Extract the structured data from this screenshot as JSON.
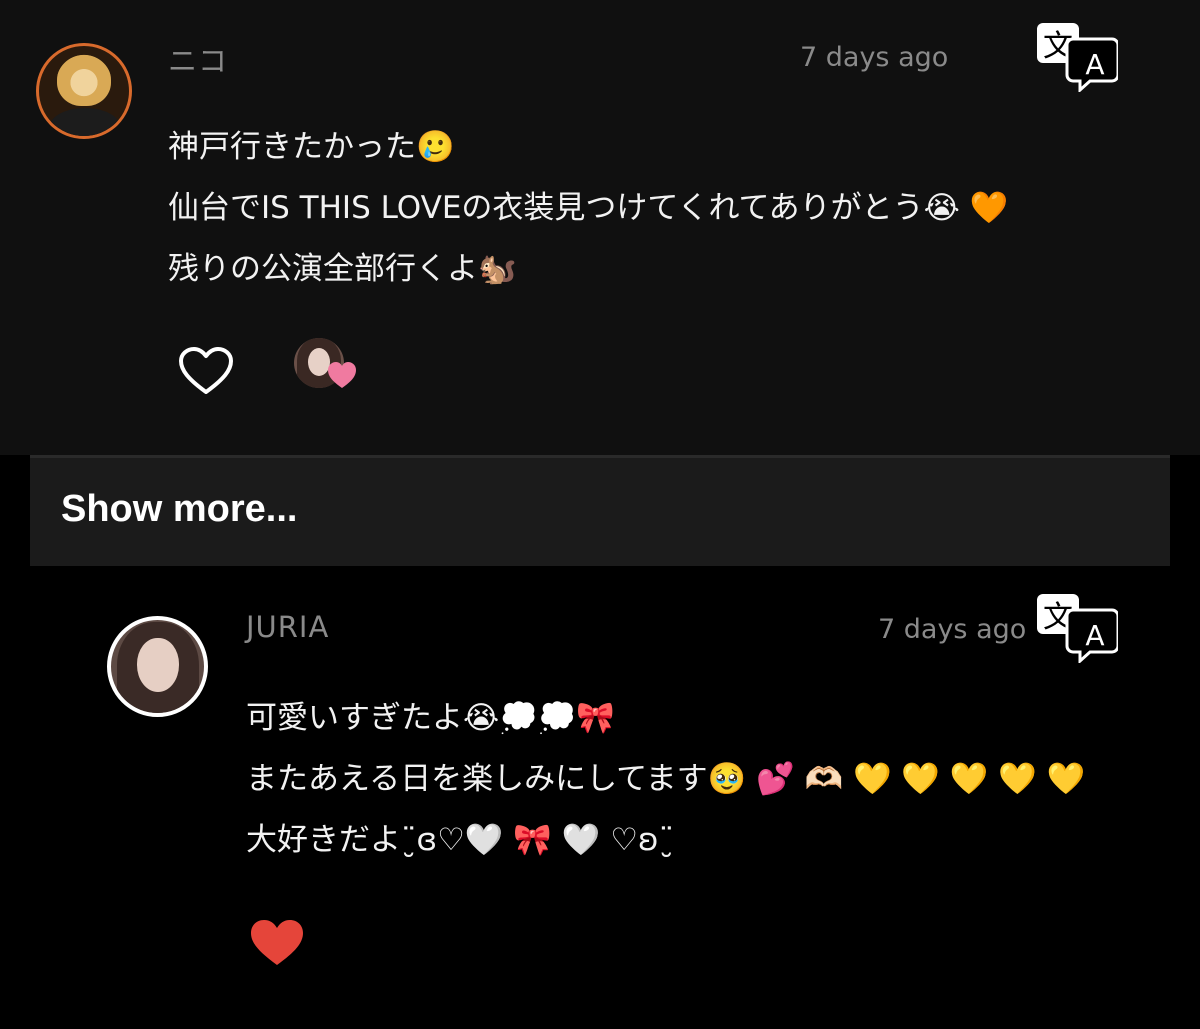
{
  "comments": [
    {
      "username": "ニコ",
      "timestamp": "7 days ago",
      "lines": [
        "神戸行きたかった🥲",
        "仙台でIS THIS LOVEの衣装見つけてくれてありがとう😭 🧡",
        "残りの公演全部行くよ🐿️"
      ],
      "liked": false
    },
    {
      "username": "JURIA",
      "timestamp": "7 days ago",
      "lines": [
        "可愛いすぎたよ😭💭💭🎀",
        "またあえる日を楽しみにしてます🥹 💕 🫶🏻 💛 💛 💛 💛 💛",
        "大好きだよ¨̮ɞ♡🤍 🎀 🤍 ♡ʚ¨̮"
      ],
      "liked": true
    }
  ],
  "show_more": {
    "label": "Show more..."
  },
  "translate_icon": {
    "name": "translate-icon",
    "glyph_top": "文",
    "glyph_bottom": "A"
  },
  "colors": {
    "like_filled": "#e5453a",
    "liker_heart": "#f07aa0",
    "niko_ring": "#d86a2c"
  }
}
